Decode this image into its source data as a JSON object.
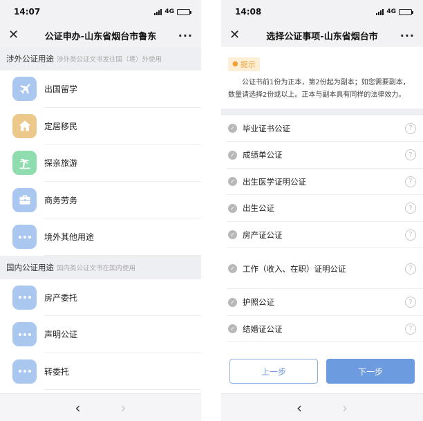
{
  "left": {
    "status": {
      "time": "14:07",
      "network": "4G"
    },
    "nav": {
      "close": "✕",
      "title": "公证申办-山东省烟台市鲁东",
      "more": "···"
    },
    "section1": {
      "title": "涉外公证用途",
      "subtitle": "涉外类公证文书发往国（境）外使用"
    },
    "items1": [
      {
        "label": "出国留学",
        "icon": "airplane-icon",
        "color": "#a9c7ef"
      },
      {
        "label": "定居移民",
        "icon": "house-icon",
        "color": "#ecc98b"
      },
      {
        "label": "探亲旅游",
        "icon": "palm-tree-icon",
        "color": "#8fdcae"
      },
      {
        "label": "商务劳务",
        "icon": "briefcase-icon",
        "color": "#a9c7ef"
      },
      {
        "label": "境外其他用途",
        "icon": "more-dots-icon",
        "color": "#a9c7ef"
      }
    ],
    "section2": {
      "title": "国内公证用途",
      "subtitle": "国内类公证文书在国内使用"
    },
    "items2": [
      {
        "label": "房产委托",
        "icon": "more-dots-icon"
      },
      {
        "label": "声明公证",
        "icon": "more-dots-icon"
      },
      {
        "label": "转委托",
        "icon": "more-dots-icon"
      }
    ],
    "bottom": {
      "back": "‹",
      "forward": "›"
    }
  },
  "right": {
    "status": {
      "time": "14:08",
      "network": "4G"
    },
    "nav": {
      "close": "✕",
      "title": "选择公证事项-山东省烟台市",
      "more": "···"
    },
    "tip": {
      "tag": "提示",
      "text": "公证书前1份为正本，第2份起为副本；如您需要副本，数量请选择2份或以上。正本与副本具有同样的法律效力。"
    },
    "items": [
      "毕业证书公证",
      "成绩单公证",
      "出生医学证明公证",
      "出生公证",
      "房产证公证",
      "工作（收入、在职）证明公证",
      "护照公证",
      "结婚证公证"
    ],
    "help_symbol": "?",
    "check_symbol": "✓",
    "buttons": {
      "prev": "上一步",
      "next": "下一步"
    },
    "bottom": {
      "back": "‹",
      "forward": "›"
    }
  }
}
